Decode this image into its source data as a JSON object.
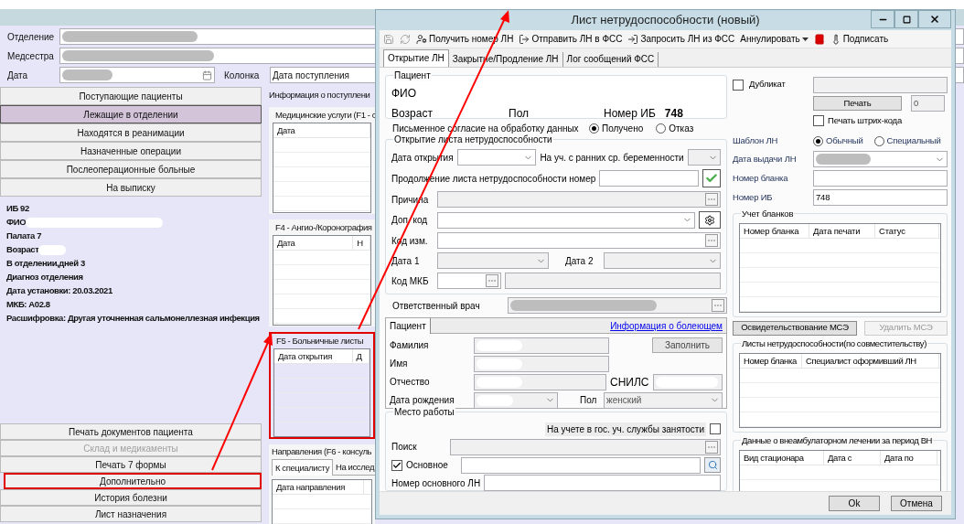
{
  "app": {
    "filters": [
      {
        "label": "Отделение",
        "redacted": true
      },
      {
        "label": "Медсестра",
        "redacted": true
      }
    ],
    "date": {
      "label": "Дата",
      "redacted": true
    },
    "column": {
      "label": "Колонка",
      "value": "Дата поступления"
    },
    "nav_buttons": [
      {
        "label": "Поступающие пациенты",
        "selected": false
      },
      {
        "label": "Лежащие в отделении",
        "selected": true
      },
      {
        "label": "Находятся в реанимации",
        "selected": false
      },
      {
        "label": "Назначенные операции",
        "selected": false
      },
      {
        "label": "Послеоперационные больные",
        "selected": false
      },
      {
        "label": "На выписку",
        "selected": false
      }
    ],
    "patient_info": [
      {
        "text": "ИБ 92",
        "redacted": false
      },
      {
        "text": "ФИО",
        "redacted": true
      },
      {
        "text": "Палата 7",
        "redacted": false
      },
      {
        "text": "Возраст",
        "redacted": true
      },
      {
        "text": "В отделении,дней 3",
        "redacted": false
      },
      {
        "text": "Диагноз отделения",
        "redacted": false
      },
      {
        "text": "Дата установки: 20.03.2021",
        "redacted": false
      },
      {
        "text": "МКБ: A02.8",
        "redacted": false
      },
      {
        "text": "Расшифровка: Другая уточненная сальмонеллезная инфекция",
        "redacted": false
      }
    ],
    "action_buttons": [
      {
        "label": "Печать документов пациента",
        "disabled": false,
        "highlighted": false
      },
      {
        "label": "Склад и медикаменты",
        "disabled": true,
        "highlighted": false
      },
      {
        "label": "Печать 7 формы",
        "disabled": false,
        "highlighted": false
      },
      {
        "label": "Дополнительно",
        "disabled": false,
        "highlighted": true
      },
      {
        "label": "История болезни",
        "disabled": false,
        "highlighted": false
      },
      {
        "label": "Лист назначения",
        "disabled": false,
        "highlighted": false
      }
    ],
    "info_header": "Информация о поступлени",
    "panels": [
      {
        "title": "Медицинские услуги (F1 - с",
        "columns": [
          "Дата"
        ],
        "highlighted": false
      },
      {
        "title": "F4 - Ангио-/Коронография",
        "columns": [
          "Дата",
          "Н"
        ],
        "highlighted": false
      },
      {
        "title": "F5 - Больничные листы",
        "columns": [
          "Дата открытия",
          "Д"
        ],
        "highlighted": true
      }
    ],
    "referrals": {
      "title": "Направления (F6 - консуль",
      "tabs": [
        {
          "label": "К специалисту",
          "selected": true
        },
        {
          "label": "На исслед",
          "selected": false
        }
      ],
      "columns": [
        "Дата направления"
      ]
    }
  },
  "dialog": {
    "title": "Лист нетрудоспособности (новый)",
    "toolbar": [
      {
        "kind": "icon",
        "disabled": true
      },
      {
        "kind": "icon",
        "disabled": true
      },
      {
        "kind": "button",
        "label": "Получить номер ЛН"
      },
      {
        "kind": "button",
        "label": "Отправить ЛН в ФСС"
      },
      {
        "kind": "button",
        "label": "Запросить ЛН из ФСС"
      },
      {
        "kind": "dropdown",
        "label": "Аннулировать"
      },
      {
        "kind": "icon",
        "disabled": false
      },
      {
        "kind": "button",
        "label": "Подписать"
      }
    ],
    "tabs": [
      {
        "label": "Открытие ЛН",
        "selected": true
      },
      {
        "label": "Закрытие/Продление ЛН",
        "selected": false
      },
      {
        "label": "Лог сообщений ФСС",
        "selected": false
      }
    ],
    "patient": {
      "title": "Пациент",
      "fio_label": "ФИО",
      "age_label": "Возраст",
      "sex_label": "Пол",
      "ib_label": "Номер ИБ",
      "ib_value": "748"
    },
    "consent": {
      "label": "Письменное согласие на обработку данных",
      "options": [
        {
          "label": "Получено",
          "selected": true
        },
        {
          "label": "Отказ",
          "selected": false
        }
      ]
    },
    "opening": {
      "title": "Открытие листа нетрудоспособности",
      "open_date": "Дата открытия",
      "pregnancy": "На уч. с ранних ср. беременности",
      "continuation": "Продолжение листа нетрудоспособности номер",
      "reason": "Причина",
      "extra_code": "Доп. код",
      "change_code": "Код изм.",
      "date1": "Дата 1",
      "date2": "Дата 2",
      "mkb": "Код МКБ"
    },
    "doctor": {
      "label": "Ответственный врач",
      "redacted": true
    },
    "sick_person": {
      "tab": "Пациент",
      "link": "Информация о болеющем",
      "fill_button": "Заполнить",
      "fields": [
        {
          "label": "Фамилия",
          "redacted": true
        },
        {
          "label": "Имя",
          "redacted": true
        },
        {
          "label": "Отчество",
          "redacted": true
        },
        {
          "label": "Дата рождения",
          "redacted": true
        }
      ],
      "snils_label": "СНИЛС",
      "sex": {
        "label": "Пол",
        "value": "женский"
      }
    },
    "work": {
      "title": "Место работы",
      "employment": {
        "label": "На учете в гос. уч. службы занятости",
        "checked": false
      },
      "search_label": "Поиск",
      "main": {
        "label": "Основное",
        "checked": true
      },
      "main_number_label": "Номер основного ЛН"
    },
    "duplicate": {
      "label": "Дубликат",
      "checked": false
    },
    "print_button": "Печать",
    "print_count": "0",
    "barcode": {
      "label": "Печать штрих-кода",
      "checked": false
    },
    "template": {
      "label": "Шаблон ЛН",
      "options": [
        {
          "label": "Обычный",
          "selected": true
        },
        {
          "label": "Специальный",
          "selected": false
        }
      ]
    },
    "issue_date": {
      "label": "Дата выдачи ЛН",
      "redacted": true
    },
    "blank_number": {
      "label": "Номер бланка"
    },
    "ib_number": {
      "label": "Номер ИБ",
      "value": "748"
    },
    "blanks": {
      "title": "Учет бланков",
      "columns": [
        "Номер бланка",
        "Дата печати",
        "Статус"
      ]
    },
    "mse_buttons": [
      {
        "label": "Освидетельствование МСЭ",
        "disabled": false
      },
      {
        "label": "Удалить МСЭ",
        "disabled": true
      }
    ],
    "part_time": {
      "title": "Листы нетрудоспособности(по совместительству)",
      "columns": [
        "Номер бланка",
        "Специалист оформивший ЛН"
      ]
    },
    "outpatient": {
      "title": "Данные о внеамбулаторном лечении за период ВН",
      "columns": [
        "Вид стационара",
        "Дата с",
        "Дата по"
      ]
    },
    "buttons": [
      {
        "label": "Ok"
      },
      {
        "label": "Отмена"
      }
    ]
  }
}
